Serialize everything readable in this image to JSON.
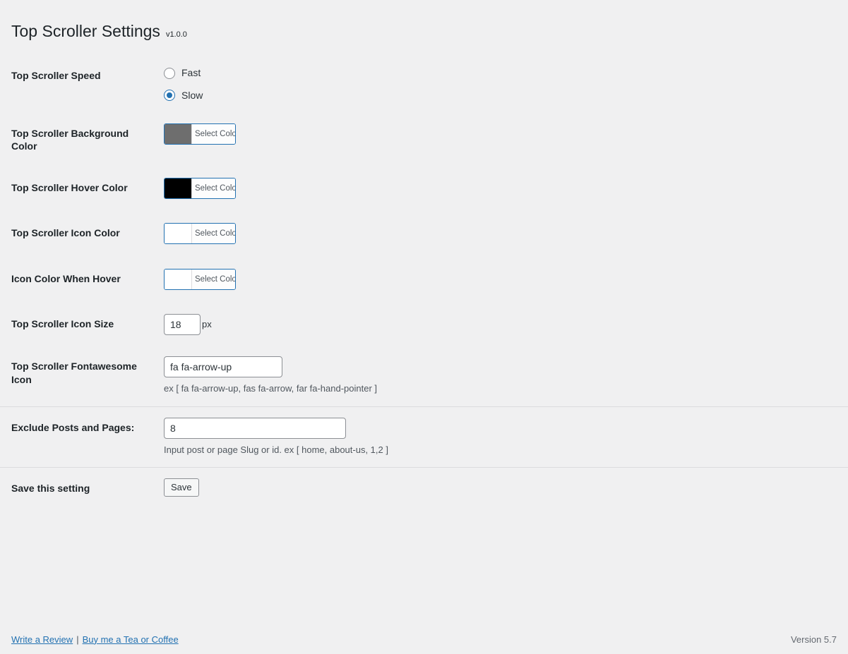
{
  "header": {
    "title": "Top Scroller Settings",
    "version": "v1.0.0"
  },
  "settings": {
    "speed": {
      "label": "Top Scroller Speed",
      "options": [
        {
          "label": "Fast",
          "value": "fast",
          "checked": false
        },
        {
          "label": "Slow",
          "value": "slow",
          "checked": true
        }
      ]
    },
    "background_color": {
      "label": "Top Scroller Background Color",
      "button_label": "Select Color",
      "swatch": "#6e6e6e"
    },
    "hover_color": {
      "label": "Top Scroller Hover Color",
      "button_label": "Select Color",
      "swatch": "#000000"
    },
    "icon_color": {
      "label": "Top Scroller Icon Color",
      "button_label": "Select Color",
      "swatch": "#ffffff"
    },
    "icon_color_hover": {
      "label": "Icon Color When Hover",
      "button_label": "Select Color",
      "swatch": "#ffffff"
    },
    "icon_size": {
      "label": "Top Scroller Icon Size",
      "value": "18",
      "unit": "px"
    },
    "fontawesome_icon": {
      "label": "Top Scroller Fontawesome Icon",
      "value": "fa fa-arrow-up",
      "hint": "ex [ fa fa-arrow-up, fas fa-arrow, far fa-hand-pointer ]"
    },
    "exclude": {
      "label": "Exclude Posts and Pages:",
      "value": "8",
      "hint": "Input post or page Slug or id. ex [ home, about-us, 1,2 ]"
    },
    "save": {
      "label": "Save this setting",
      "button_label": "Save"
    }
  },
  "footer": {
    "review_link": "Write a Review",
    "separator": "|",
    "donate_link": "Buy me a Tea or Coffee",
    "version_text": "Version 5.7"
  },
  "colors": {
    "accent": "#2271b1",
    "background": "#f0f0f1",
    "text": "#1d2327"
  }
}
